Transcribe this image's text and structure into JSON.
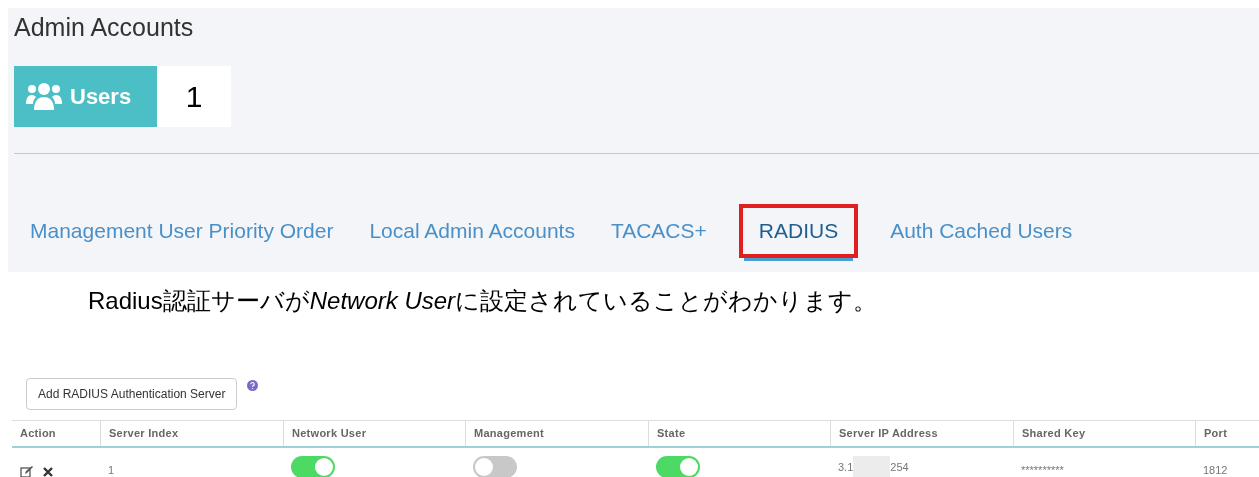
{
  "panel": {
    "title": "Admin Accounts",
    "users_tile": {
      "label": "Users",
      "count": "1"
    },
    "tabs": [
      {
        "label": "Management User Priority Order",
        "selected": false
      },
      {
        "label": "Local Admin Accounts",
        "selected": false
      },
      {
        "label": "TACACS+",
        "selected": false
      },
      {
        "label": "RADIUS",
        "selected": true,
        "highlighted": true
      },
      {
        "label": "Auth Cached Users",
        "selected": false
      }
    ]
  },
  "caption": [
    {
      "text": "Radius認証サーバが",
      "italic": false
    },
    {
      "text": "Network User",
      "italic": true
    },
    {
      "text": "に設定されていることがわかります。",
      "italic": false
    }
  ],
  "radius": {
    "add_button": "Add RADIUS Authentication Server",
    "table": {
      "columns": [
        "Action",
        "Server Index",
        "Network User",
        "Management",
        "State",
        "Server IP Address",
        "Shared Key",
        "Port"
      ],
      "rows": [
        {
          "server_index": "1",
          "network_user": true,
          "management": false,
          "state": true,
          "ip_start": "3.1",
          "ip_end": "254",
          "shared_key": "**********",
          "port": "1812"
        }
      ]
    }
  }
}
